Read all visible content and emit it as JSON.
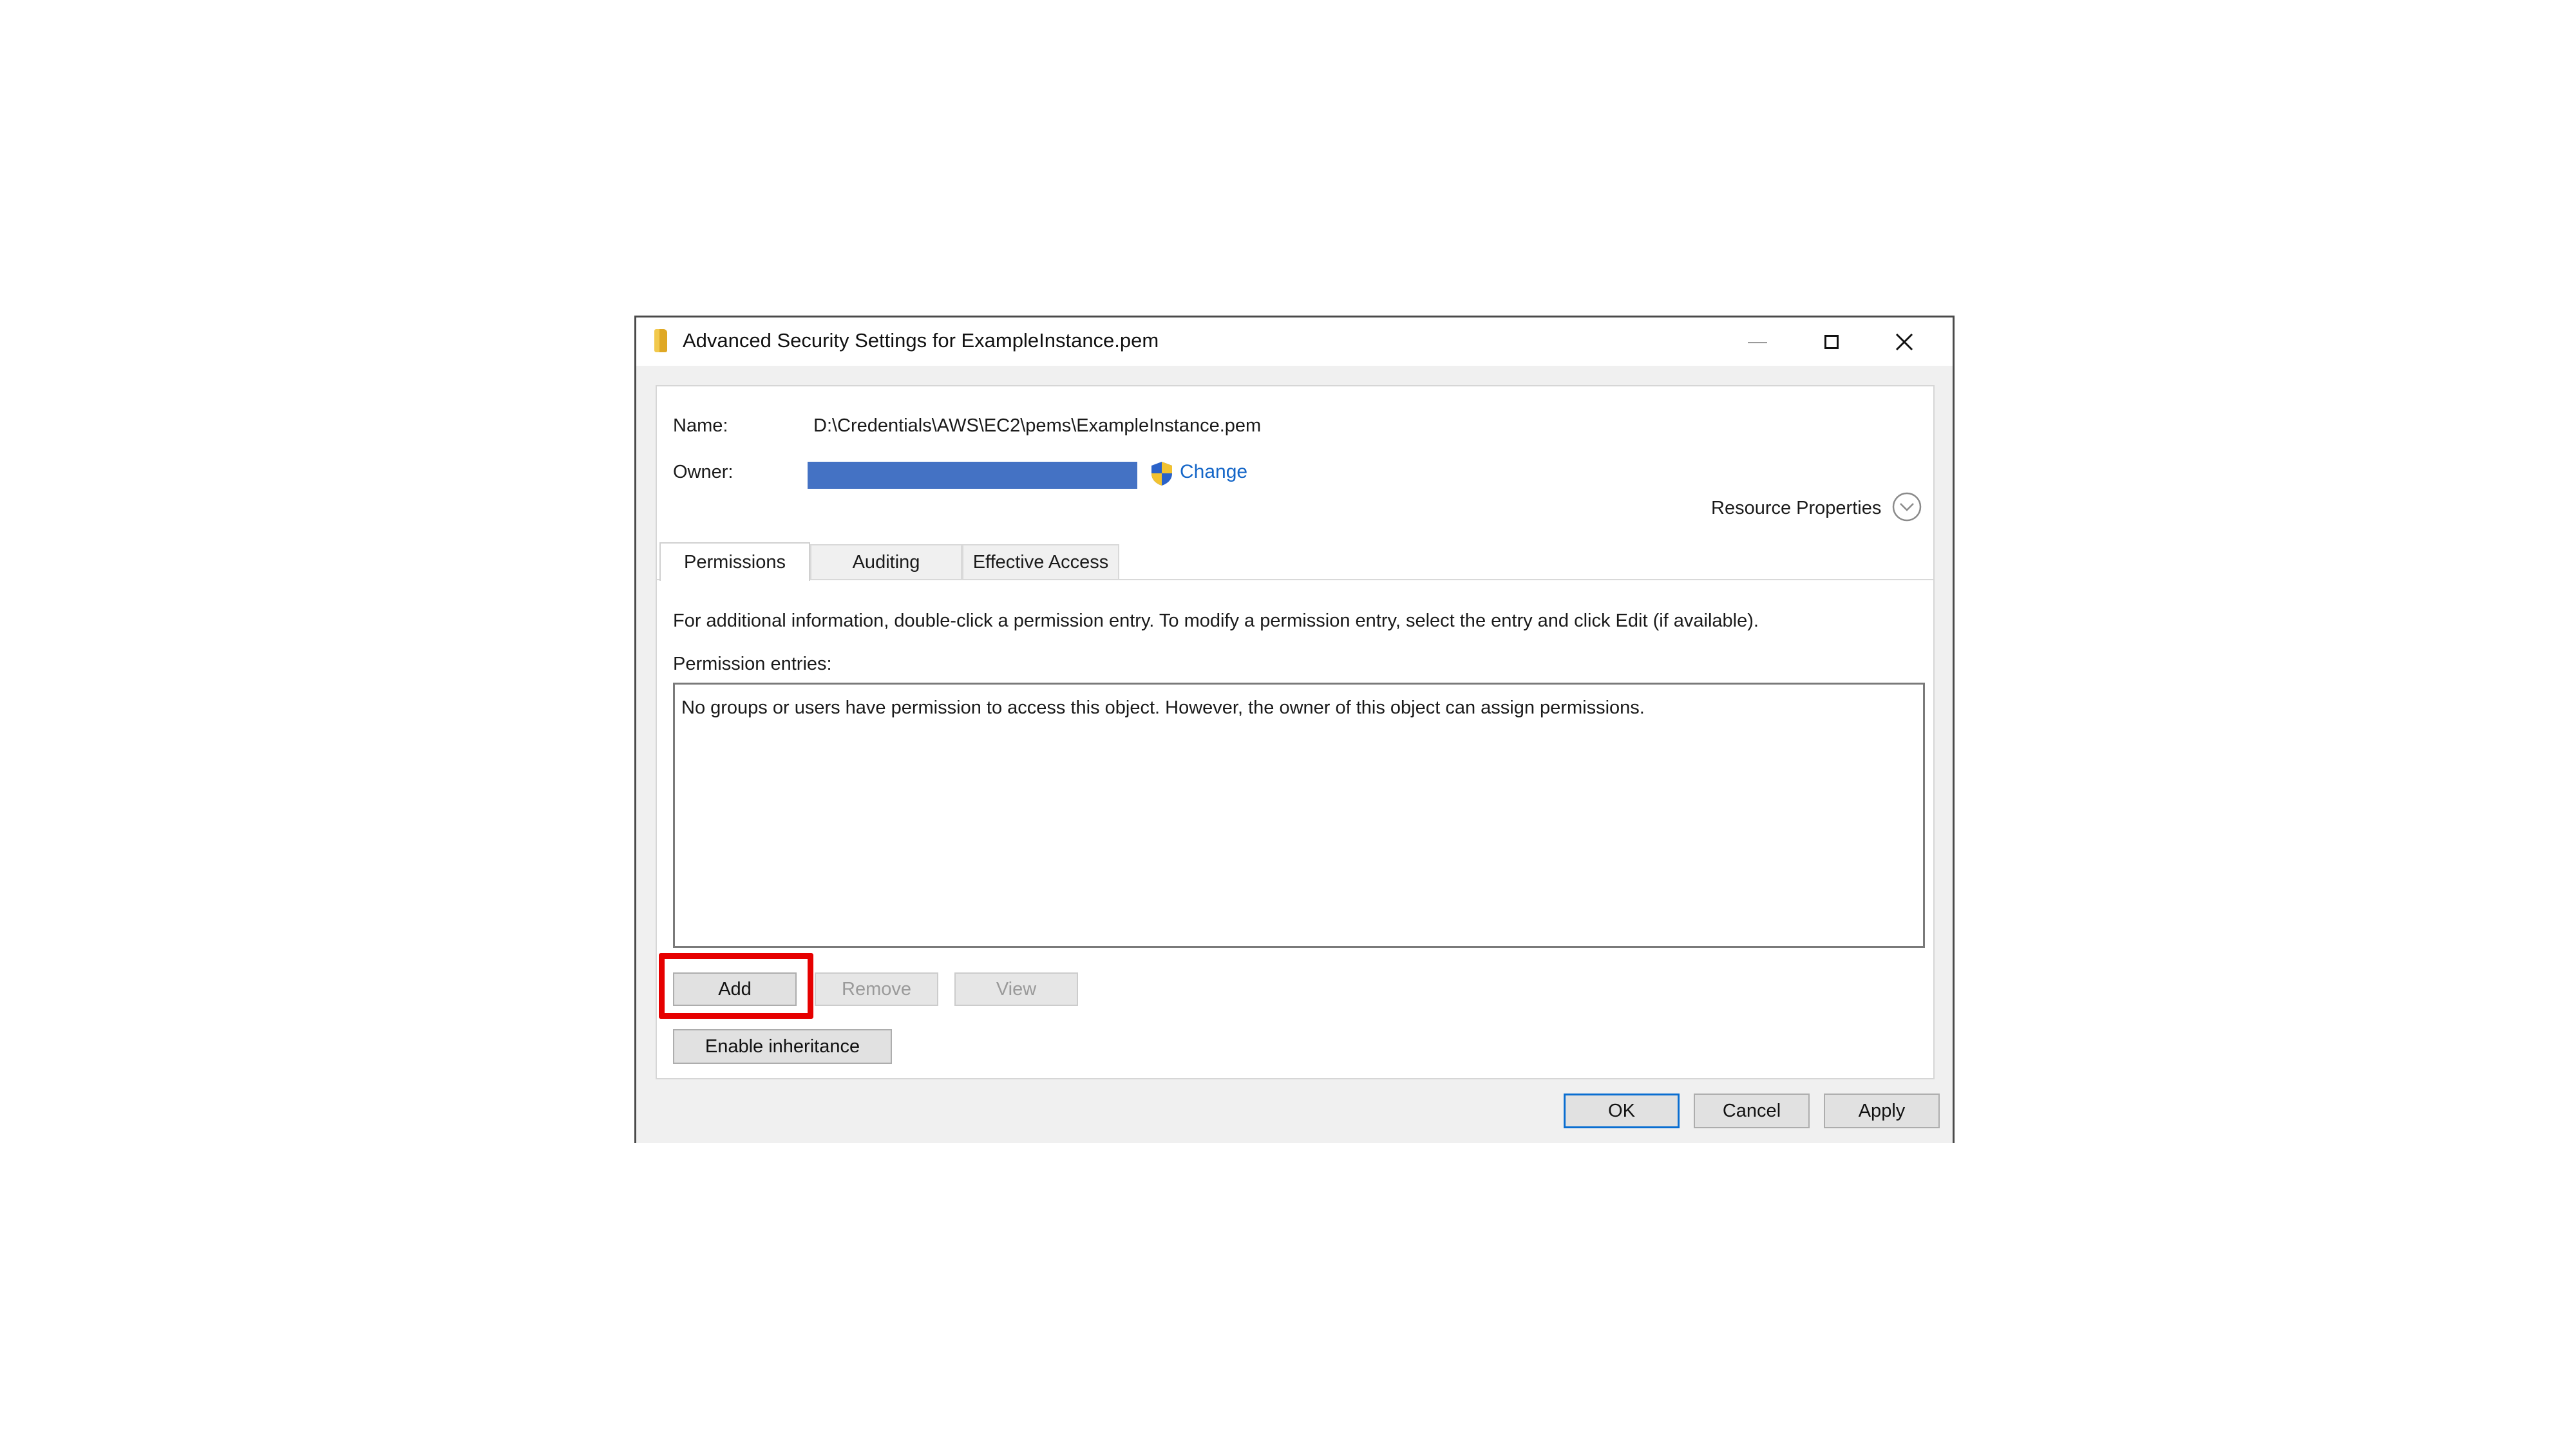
{
  "window": {
    "title": "Advanced Security Settings for ExampleInstance.pem",
    "icon": "folder-icon"
  },
  "details": {
    "name_label": "Name:",
    "name_value": "D:\\Credentials\\AWS\\EC2\\pems\\ExampleInstance.pem",
    "owner_label": "Owner:",
    "owner_value_redacted": true,
    "change_link": "Change",
    "resource_properties": "Resource Properties"
  },
  "tabs": [
    {
      "label": "Permissions",
      "active": true
    },
    {
      "label": "Auditing",
      "active": false
    },
    {
      "label": "Effective Access",
      "active": false
    }
  ],
  "permissions": {
    "info_text": "For additional information, double-click a permission entry. To modify a permission entry, select the entry and click Edit (if available).",
    "entries_label": "Permission entries:",
    "empty_message": "No groups or users have permission to access this object. However, the owner of this object can assign permissions."
  },
  "buttons": {
    "add": "Add",
    "remove": "Remove",
    "view": "View",
    "enable_inheritance": "Enable inheritance",
    "ok": "OK",
    "cancel": "Cancel",
    "apply": "Apply"
  },
  "colors": {
    "highlight": "#e60000",
    "owner_redaction": "#4472c4",
    "link": "#1466c8",
    "ok_border": "#0a6ed1"
  }
}
